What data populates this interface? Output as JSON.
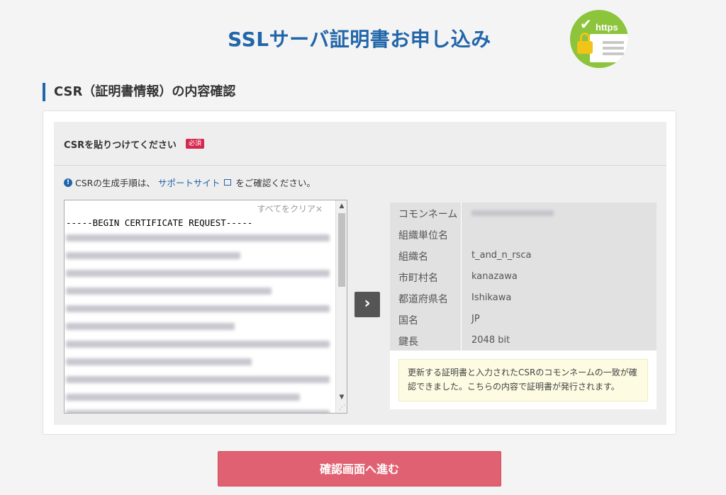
{
  "page": {
    "title": "SSLサーバ証明書お申し込み"
  },
  "badge": {
    "label": "https"
  },
  "section": {
    "heading": "CSR（証明書情報）の内容確認"
  },
  "csr": {
    "label": "CSRを貼りつけてください",
    "required": "必須",
    "note_prefix": "CSRの生成手順は、",
    "note_link": "サポートサイト",
    "note_suffix": "をご確認ください。",
    "clear": "すべてをクリア×",
    "begin_line": "-----BEGIN CERTIFICATE REQUEST-----"
  },
  "info": {
    "rows": [
      {
        "key": "コモンネーム",
        "value": ""
      },
      {
        "key": "組織単位名",
        "value": ""
      },
      {
        "key": "組織名",
        "value": "t_and_n_rsca"
      },
      {
        "key": "市町村名",
        "value": "kanazawa"
      },
      {
        "key": "都道府県名",
        "value": "Ishikawa"
      },
      {
        "key": "国名",
        "value": "JP"
      },
      {
        "key": "鍵長",
        "value": "2048 bit"
      }
    ],
    "message": "更新する証明書と入力されたCSRのコモンネームの一致が確認できました。こちらの内容で証明書が発行されます。"
  },
  "submit": {
    "label": "確認画面へ進む"
  }
}
